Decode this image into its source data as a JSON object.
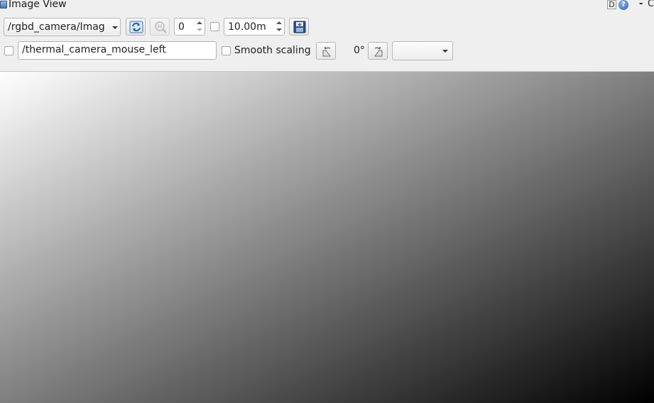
{
  "window": {
    "title": "Image View",
    "title_buttons": {
      "dock_label": "D",
      "help_label": "?",
      "minimize_label": "-",
      "close_label": "C"
    }
  },
  "toolbar": {
    "topic_combo": {
      "value": "/rgbd_camera/Imag"
    },
    "refresh_icon": "refresh-icon",
    "zoom_icon": "zoom-fit-icon",
    "frame_spin": {
      "value": "0"
    },
    "max_range_check": {
      "checked": false
    },
    "max_range_spin": {
      "value": "10.00m"
    },
    "save_icon": "save-image-icon"
  },
  "second_row": {
    "mouse_topic_check": {
      "checked": false
    },
    "mouse_topic_field": {
      "value": "/thermal_camera_mouse_left"
    },
    "smooth_scaling": {
      "checked": false,
      "label": "Smooth scaling"
    },
    "rotate_left_icon": "rotate-left-icon",
    "rotation_label": "0°",
    "rotate_right_icon": "rotate-right-icon",
    "color_scheme_combo": {
      "value": ""
    }
  },
  "image": {
    "gradient_start": "#ffffff",
    "gradient_end": "#000000"
  }
}
